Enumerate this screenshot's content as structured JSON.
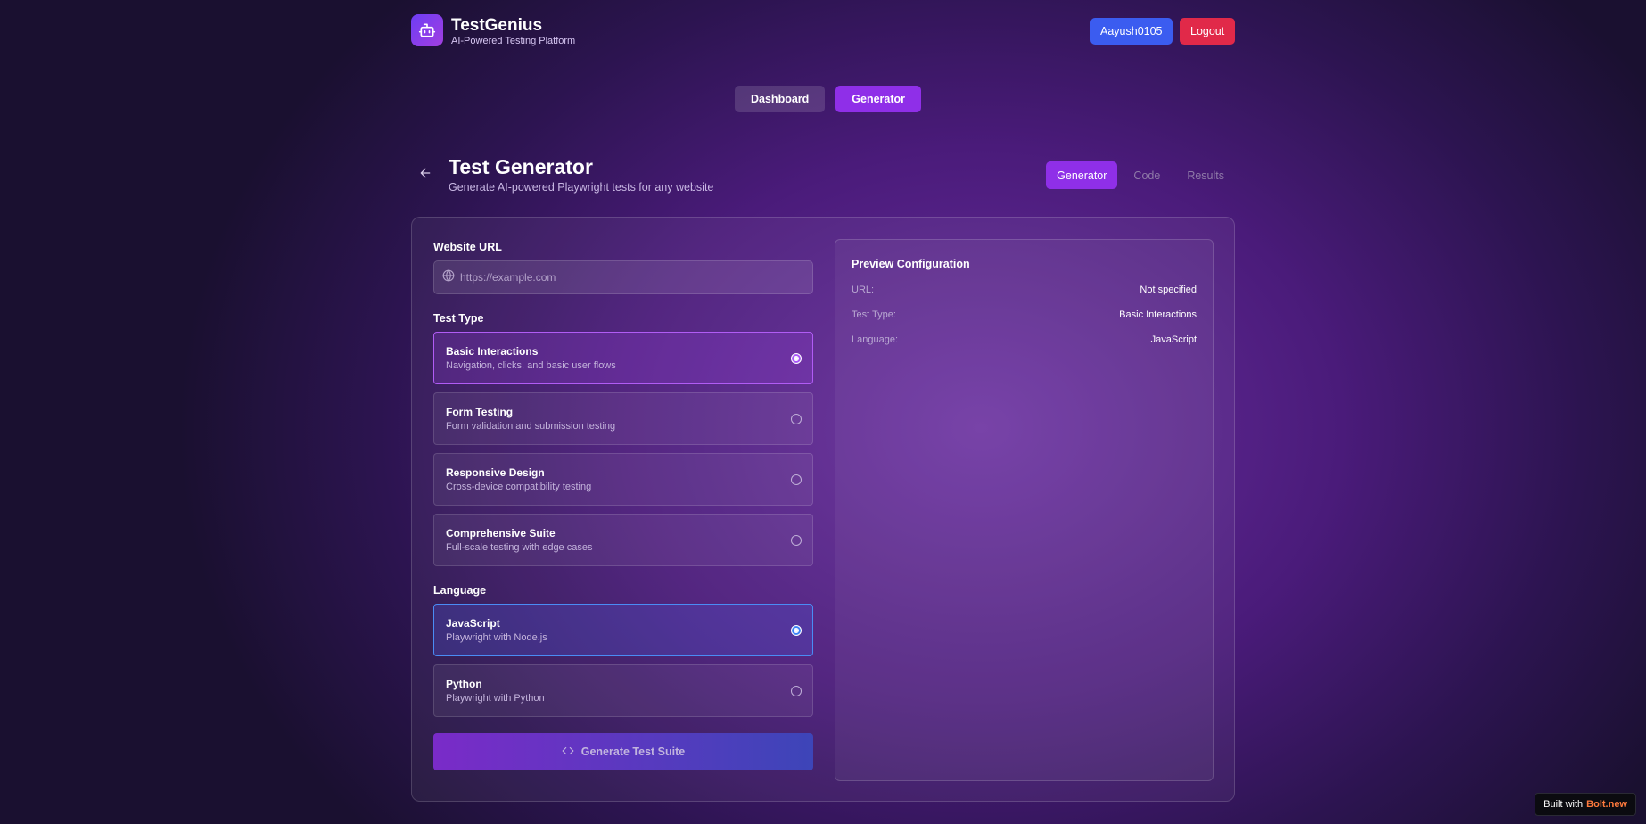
{
  "header": {
    "app_title": "TestGenius",
    "app_subtitle": "AI-Powered Testing Platform",
    "username": "Aayush0105",
    "logout_label": "Logout"
  },
  "topnav": {
    "dashboard_label": "Dashboard",
    "generator_label": "Generator"
  },
  "page": {
    "title": "Test Generator",
    "subtitle": "Generate AI-powered Playwright tests for any website",
    "tabs": [
      "Generator",
      "Code",
      "Results"
    ]
  },
  "form": {
    "url_label": "Website URL",
    "url_placeholder": "https://example.com",
    "url_value": "",
    "test_type_label": "Test Type",
    "test_types": [
      {
        "title": "Basic Interactions",
        "desc": "Navigation, clicks, and basic user flows",
        "selected": true
      },
      {
        "title": "Form Testing",
        "desc": "Form validation and submission testing",
        "selected": false
      },
      {
        "title": "Responsive Design",
        "desc": "Cross-device compatibility testing",
        "selected": false
      },
      {
        "title": "Comprehensive Suite",
        "desc": "Full-scale testing with edge cases",
        "selected": false
      }
    ],
    "language_label": "Language",
    "languages": [
      {
        "title": "JavaScript",
        "desc": "Playwright with Node.js",
        "selected": true
      },
      {
        "title": "Python",
        "desc": "Playwright with Python",
        "selected": false
      }
    ],
    "generate_label": "Generate Test Suite"
  },
  "preview": {
    "title": "Preview Configuration",
    "url_key": "URL:",
    "url_value": "Not specified",
    "type_key": "Test Type:",
    "type_value": "Basic Interactions",
    "lang_key": "Language:",
    "lang_value": "JavaScript"
  },
  "badge": {
    "prefix": "Built with",
    "brand": "Bolt.new"
  },
  "colors": {
    "accent_purple": "#8f2fe8",
    "user_blue": "#3b5cf0",
    "logout_red": "#e12949"
  }
}
